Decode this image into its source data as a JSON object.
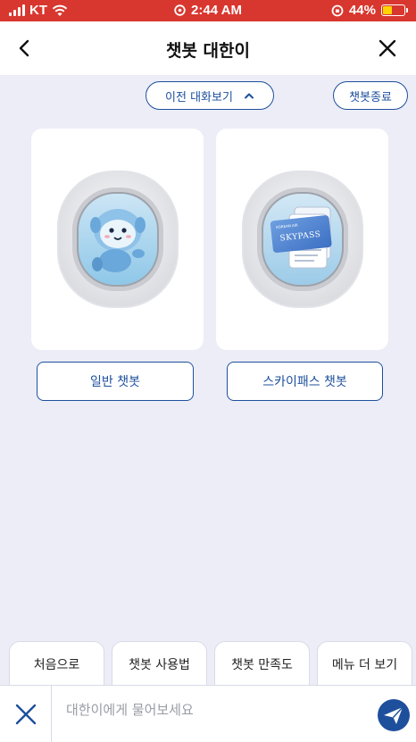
{
  "status_bar": {
    "carrier": "KT",
    "time": "2:44 AM",
    "battery_text": "44%",
    "battery_level": 0.44,
    "background": "#d8372f"
  },
  "header": {
    "title": "챗봇 대한이"
  },
  "top_buttons": {
    "history_label": "이전 대화보기",
    "end_label": "챗봇종료"
  },
  "cards": [
    {
      "image": "mascot-airplane-window",
      "button_label": "일반 챗봇"
    },
    {
      "image": "skypass-card-airplane-window",
      "button_label": "스카이패스 챗봇",
      "card_text": "SKYPASS"
    }
  ],
  "quick_menu": [
    "처음으로",
    "챗봇 사용법",
    "챗봇 만족도",
    "메뉴 더 보기"
  ],
  "input": {
    "placeholder": "대한이에게 물어보세요"
  },
  "colors": {
    "accent": "#1d4f9c",
    "background": "#ecedf7",
    "status_bar": "#d8372f"
  }
}
